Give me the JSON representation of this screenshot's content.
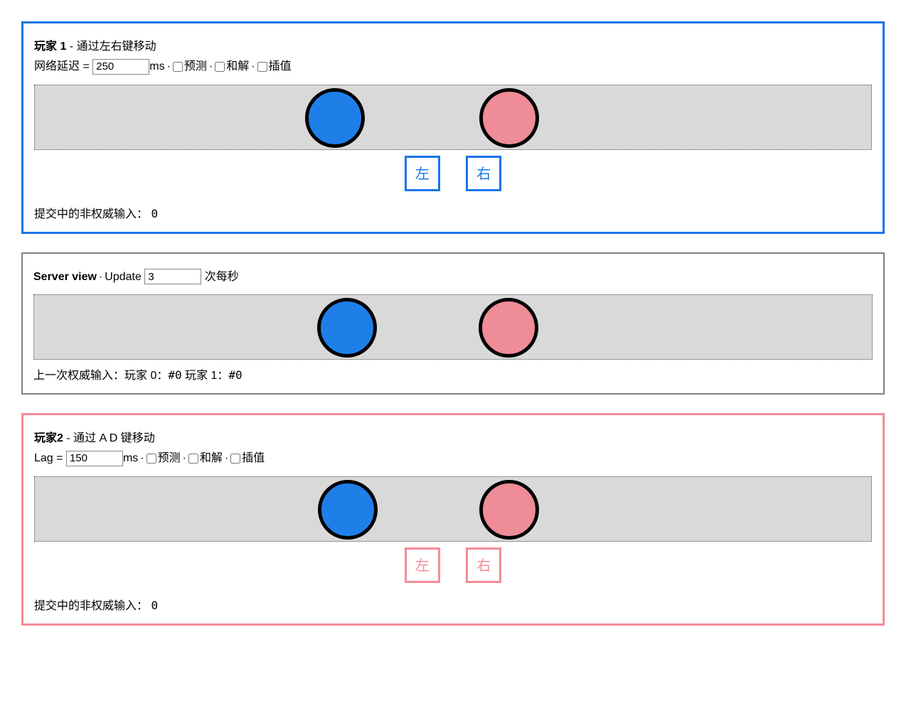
{
  "player1": {
    "title": "玩家 1",
    "title_suffix": " - 通过左右键移动",
    "lag_label": "网络延迟 = ",
    "lag_value": "250",
    "ms_label": "ms",
    "prediction_label": "预测",
    "reconcile_label": "和解",
    "interp_label": "插值",
    "btn_left": "左",
    "btn_right": "右",
    "status_label": "提交中的非权威输入：",
    "status_value": "0",
    "ball_blue_left": "380",
    "ball_red_left": "625"
  },
  "server": {
    "title": "Server view",
    "update_label": "Update",
    "update_value": "3",
    "rate_label": "次每秒",
    "status_prefix": "上一次权威输入：玩家 0：",
    "p0_tag": "#0",
    "mid_label": " 玩家 1：",
    "p1_tag": "#0",
    "ball_blue_left": "398",
    "ball_red_left": "625"
  },
  "player2": {
    "title": "玩家2",
    "title_suffix": " - 通过 A D 键移动",
    "lag_label": "Lag = ",
    "lag_value": "150",
    "ms_label": "ms",
    "prediction_label": "预测",
    "reconcile_label": "和解",
    "interp_label": "插值",
    "btn_left": "左",
    "btn_right": "右",
    "status_label": "提交中的非权威输入：",
    "status_value": "0",
    "ball_blue_left": "398",
    "ball_red_left": "625"
  },
  "dot": " · "
}
